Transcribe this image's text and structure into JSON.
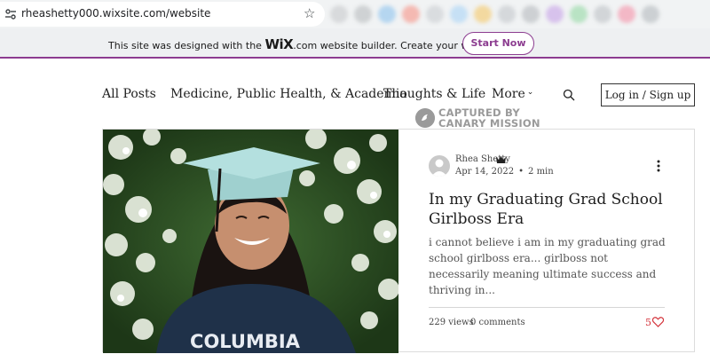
{
  "browser": {
    "url": "rheashetty000.wixsite.com/website",
    "site_info_icon": "tune-icon",
    "bookmark_icon": "star-icon",
    "extension_colors": [
      "#d8dadc",
      "#cfd2d4",
      "#b5d6f0",
      "#f4b9b2",
      "#d9dcdf",
      "#c6e0f5",
      "#f3d9a0",
      "#d5d8db",
      "#cdd0d3",
      "#d7c2ec",
      "#b9e3c4",
      "#d2d5d8",
      "#f3b8c6",
      "#ccd0d3"
    ]
  },
  "wix_banner": {
    "text_before": "This site was designed with the ",
    "logo": "WiX",
    "text_after": ".com website builder. Create your website today.",
    "cta": "Start Now",
    "accent": "#8c3c90"
  },
  "nav": {
    "items": [
      "All Posts",
      "Medicine, Public Health, & Academia",
      "Thoughts & Life",
      "More"
    ],
    "more_icon": "chevron-down-icon",
    "search_icon": "search-icon",
    "login": "Log in / Sign up"
  },
  "watermark": {
    "line1": "CAPTURED BY",
    "line2": "CANARY MISSION",
    "icon": "canary-bird-icon"
  },
  "post": {
    "author": "Rhea Shetty",
    "author_badge_icon": "crown-icon",
    "date": "Apr 14, 2022",
    "read_time": "2 min",
    "title": "In my Graduating Grad School Girlboss Era",
    "excerpt": "i cannot believe i am in my graduating grad school girlboss era... girlboss not necessarily meaning ultimate success and thriving in...",
    "views": "229 views",
    "comments": "0 comments",
    "likes": "5",
    "shirt_text": "COLUMBIA",
    "like_color": "#d4343c"
  }
}
